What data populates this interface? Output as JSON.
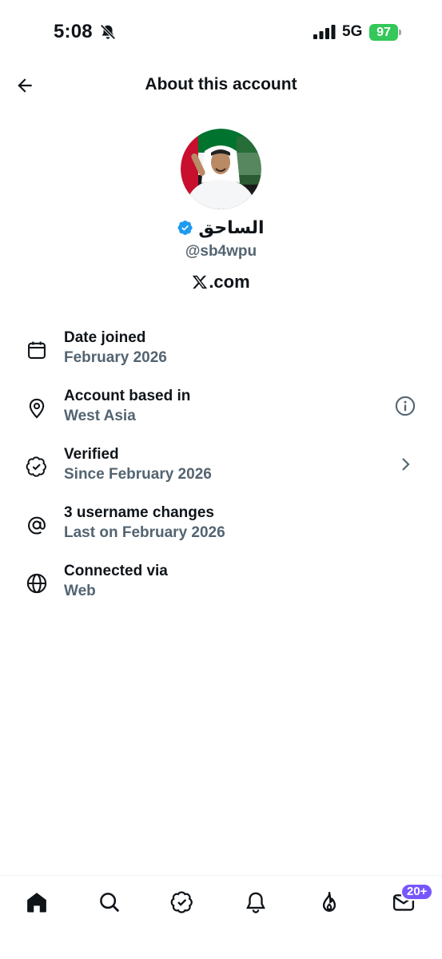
{
  "status_bar": {
    "time": "5:08",
    "network": "5G",
    "battery": "97"
  },
  "header": {
    "title": "About this account",
    "back_icon": "arrow-left-icon"
  },
  "profile": {
    "display_name": "الساحق",
    "username": "@sb4wpu",
    "domain": ".com",
    "verified_color": "#1d9bf0"
  },
  "rows": [
    {
      "icon": "calendar-icon",
      "title": "Date joined",
      "subtitle": "February 2026"
    },
    {
      "icon": "location-pin-icon",
      "title": "Account based in",
      "subtitle": "West Asia",
      "action": "info-icon"
    },
    {
      "icon": "verified-badge-icon",
      "title": "Verified",
      "subtitle": "Since February 2026",
      "action": "chevron-right-icon"
    },
    {
      "icon": "at-sign-icon",
      "title": "3 username changes",
      "subtitle": "Last on February 2026"
    },
    {
      "icon": "globe-icon",
      "title": "Connected via",
      "subtitle": "Web"
    }
  ],
  "bottom_nav": {
    "items": [
      "home-icon",
      "search-icon",
      "verified-icon",
      "bell-icon",
      "flame-icon",
      "mail-icon"
    ],
    "badge": "20+",
    "badge_color": "#7856ff"
  }
}
